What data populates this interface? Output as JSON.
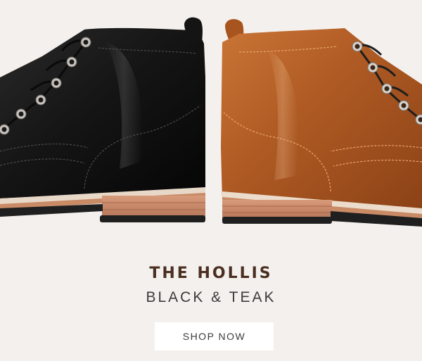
{
  "product": {
    "title": "THE HOLLIS",
    "variants_label": "BLACK & TEAK"
  },
  "cta": {
    "label": "SHOP NOW"
  },
  "colors": {
    "background": "#f4f0ee",
    "title": "#4a2f21",
    "black_boot": "#1b1b1b",
    "teak_boot": "#b9642b"
  }
}
